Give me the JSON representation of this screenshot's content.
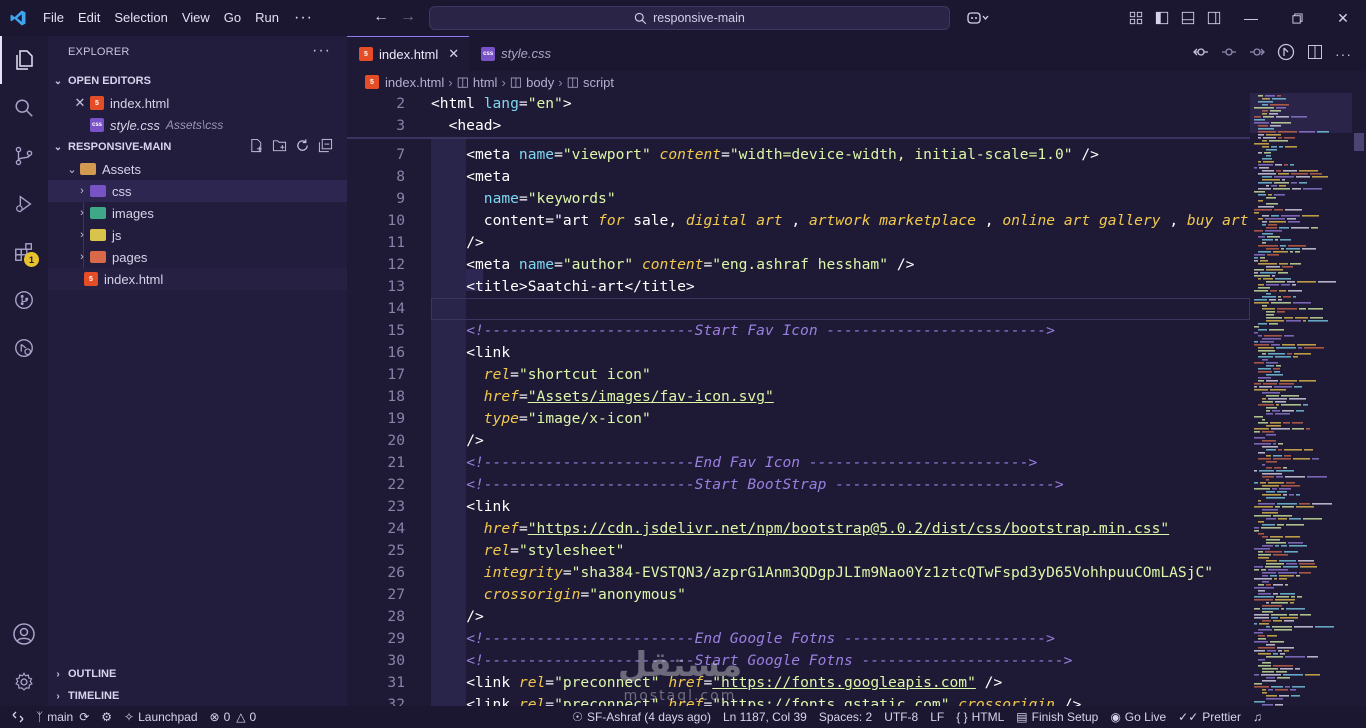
{
  "menu": [
    "File",
    "Edit",
    "Selection",
    "View",
    "Go",
    "Run",
    "···"
  ],
  "search_text": "responsive-main",
  "activity": {
    "extensions_badge": "1"
  },
  "sidebar": {
    "explorer_title": "EXPLORER",
    "open_editors_title": "OPEN EDITORS",
    "open_editors": [
      {
        "name": "index.html",
        "sub": ""
      },
      {
        "name": "style.css",
        "sub": "Assets\\css"
      }
    ],
    "project_title": "RESPONSIVE-MAIN",
    "tree": [
      {
        "name": "Assets"
      },
      {
        "name": "css"
      },
      {
        "name": "images"
      },
      {
        "name": "js"
      },
      {
        "name": "pages"
      },
      {
        "name": "index.html"
      }
    ],
    "outline_title": "OUTLINE",
    "timeline_title": "TIMELINE"
  },
  "tabs": [
    {
      "label": "index.html",
      "icon": "html-file-icon"
    },
    {
      "label": "style.css",
      "icon": "css-file-icon"
    }
  ],
  "breadcrumb": [
    "index.html",
    "html",
    "body",
    "script"
  ],
  "code": {
    "sticky": [
      {
        "n": "2",
        "t": "<html lang=\"en\">"
      },
      {
        "n": "3",
        "t": "<head>"
      }
    ],
    "lines": [
      {
        "n": "7",
        "t": "<meta name=\"viewport\" content=\"width=device-width, initial-scale=1.0\" />"
      },
      {
        "n": "8",
        "t": "<meta"
      },
      {
        "n": "9",
        "t": "name=\"keywords\""
      },
      {
        "n": "10",
        "t": "content=\"art for sale, digital art , artwork marketplace , online art gallery , buy art"
      },
      {
        "n": "11",
        "t": "/>"
      },
      {
        "n": "12",
        "t": "<meta name=\"author\" content=\"eng.ashraf hessham\" />"
      },
      {
        "n": "13",
        "t": "<title>Saatchi-art</title>"
      },
      {
        "n": "14",
        "t": ""
      },
      {
        "n": "15",
        "t": "<!------------------------Start Fav Icon ------------------------->"
      },
      {
        "n": "16",
        "t": "<link"
      },
      {
        "n": "17",
        "t": "rel=\"shortcut icon\""
      },
      {
        "n": "18",
        "t": "href=\"Assets/images/fav-icon.svg\""
      },
      {
        "n": "19",
        "t": "type=\"image/x-icon\""
      },
      {
        "n": "20",
        "t": "/>"
      },
      {
        "n": "21",
        "t": "<!------------------------End Fav Icon ------------------------->"
      },
      {
        "n": "22",
        "t": "<!------------------------Start BootStrap ------------------------->"
      },
      {
        "n": "23",
        "t": "<link"
      },
      {
        "n": "24",
        "t": "href=\"https://cdn.jsdelivr.net/npm/bootstrap@5.0.2/dist/css/bootstrap.min.css\""
      },
      {
        "n": "25",
        "t": "rel=\"stylesheet\""
      },
      {
        "n": "26",
        "t": "integrity=\"sha384-EVSTQN3/azprG1Anm3QDgpJLIm9Nao0Yz1ztcQTwFspd3yD65VohhpuuCOmLASjC\""
      },
      {
        "n": "27",
        "t": "crossorigin=\"anonymous\""
      },
      {
        "n": "28",
        "t": "/>"
      },
      {
        "n": "29",
        "t": "<!------------------------End Google Fotns ----------------------->"
      },
      {
        "n": "30",
        "t": "<!------------------------Start Google Fotns ----------------------->"
      },
      {
        "n": "31",
        "t": "<link rel=\"preconnect\" href=\"https://fonts.googleapis.com\" />"
      },
      {
        "n": "32",
        "t": "<link rel=\"preconnect\" href=\"https://fonts.gstatic.com\" crossorigin />"
      }
    ]
  },
  "status": {
    "branch": "main",
    "launchpad": "Launchpad",
    "problems": "0",
    "warnings": "0",
    "blame": "SF-Ashraf (4 days ago)",
    "position": "Ln 1187, Col 39",
    "spaces": "Spaces: 2",
    "encoding": "UTF-8",
    "eol": "LF",
    "language": "HTML",
    "finish_setup": "Finish Setup",
    "go_live": "Go Live",
    "prettier": "Prettier"
  },
  "watermark": {
    "arabic": "مستقل",
    "latin": "mostaql.com"
  },
  "colors": {
    "background": "#1e1a36",
    "sidebar": "#221d3c",
    "titlebar": "#1b1730",
    "attr_name": "#7fd7f2",
    "attr_name_italic": "#f2c94c",
    "attr_value": "#ddf7a8",
    "comment": "#9a7fe0",
    "badge": "#e8c22e"
  }
}
